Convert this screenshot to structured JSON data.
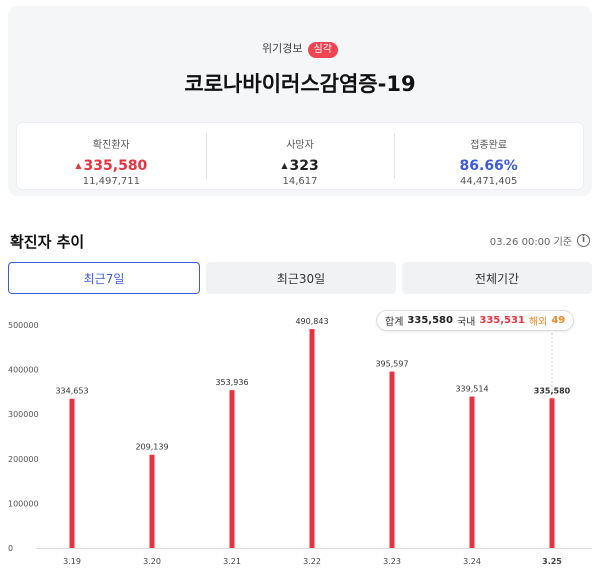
{
  "header": {
    "alert_label": "위기경보",
    "alert_level": "심각",
    "title": "코로나바이러스감염증-19"
  },
  "stats": [
    {
      "label": "확진환자",
      "value": "335,580",
      "sub": "11,497,711",
      "trend": "up",
      "color": "#e8343e"
    },
    {
      "label": "사망자",
      "value": "323",
      "sub": "14,617",
      "trend": "up",
      "color": "#222222"
    },
    {
      "label": "접종완료",
      "value": "86.66%",
      "sub": "44,471,405",
      "trend": "",
      "color": "#3d5bd8"
    }
  ],
  "section": {
    "title": "확진자 추이",
    "as_of": "03.26 00:00 기준",
    "info_icon": "info-icon"
  },
  "tabs": [
    {
      "label": "최근7일",
      "active": true
    },
    {
      "label": "최근30일",
      "active": false
    },
    {
      "label": "전체기간",
      "active": false
    }
  ],
  "tooltip": {
    "total_label": "합계",
    "total": "335,580",
    "domestic_label": "국내",
    "domestic": "335,531",
    "abroad_label": "해외",
    "abroad": "49"
  },
  "chart_data": {
    "type": "bar",
    "categories": [
      "3.19",
      "3.20",
      "3.21",
      "3.22",
      "3.23",
      "3.24",
      "3.25"
    ],
    "values": [
      334653,
      209139,
      353936,
      490843,
      395597,
      339514,
      335580
    ],
    "labels": [
      "334,653",
      "209,139",
      "353,936",
      "490,843",
      "395,597",
      "339,514",
      "335,580"
    ],
    "ylim": [
      0,
      500000
    ],
    "yticks": [
      0,
      100000,
      200000,
      300000,
      400000,
      500000
    ],
    "ytick_labels": [
      "0",
      "100000",
      "200000",
      "300000",
      "400000",
      "500000"
    ],
    "highlight_index": 6,
    "bar_color": "#e8343e",
    "grid": false
  }
}
